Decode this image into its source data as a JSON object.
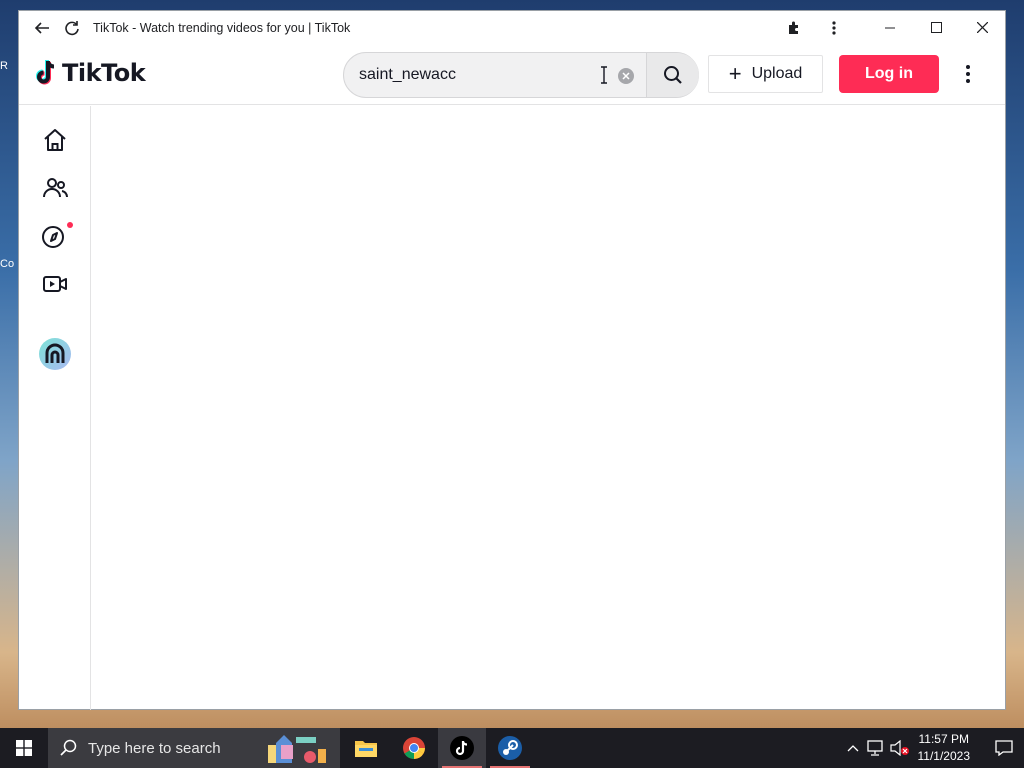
{
  "browser": {
    "title": "TikTok - Watch trending videos for you | TikTok"
  },
  "header": {
    "logo_text": "TikTok",
    "search": {
      "value": "saint_newacc",
      "placeholder": "Search"
    },
    "upload_label": "Upload",
    "login_label": "Log in"
  },
  "sidebar": {
    "items": [
      {
        "name": "home",
        "icon": "home-icon"
      },
      {
        "name": "following",
        "icon": "people-icon"
      },
      {
        "name": "explore",
        "icon": "compass-icon",
        "has_notification_dot": true
      },
      {
        "name": "live",
        "icon": "video-camera-icon"
      }
    ]
  },
  "taskbar": {
    "search_text": "Type here to search",
    "time": "11:57 PM",
    "date": "11/1/2023"
  },
  "colors": {
    "brand_pink": "#fe2c55",
    "text_dark": "#161823",
    "taskbar_bg": "#1c1c22"
  }
}
